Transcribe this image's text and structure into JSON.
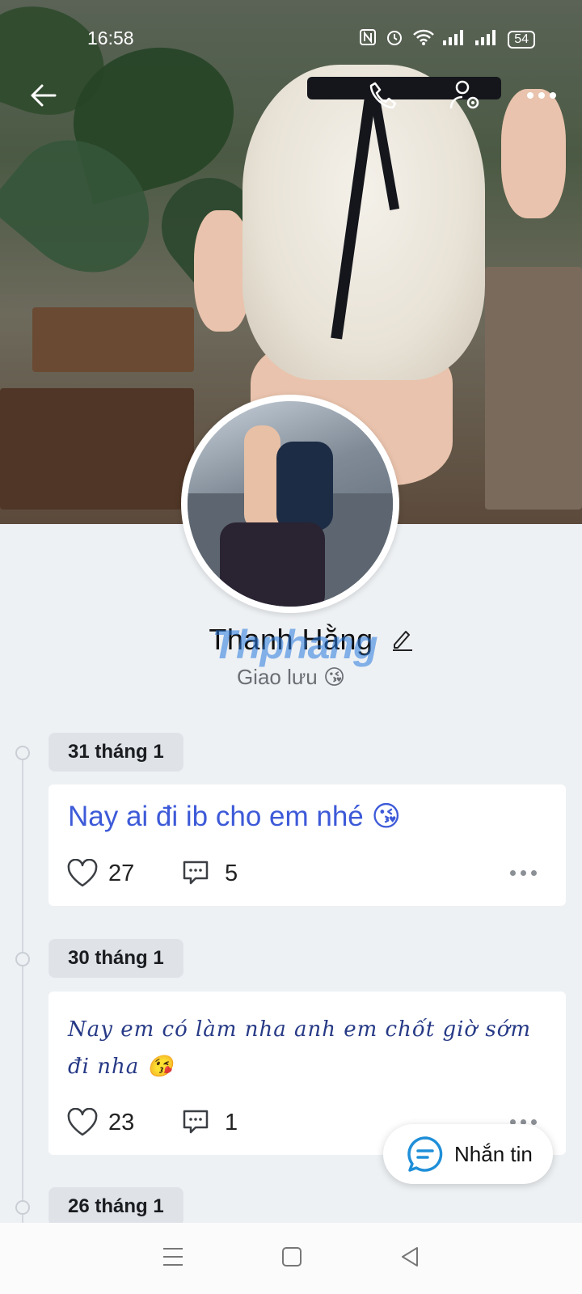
{
  "status_bar": {
    "time": "16:58",
    "battery": "54",
    "icons": [
      "nfc-icon",
      "alarm-icon",
      "wifi-icon",
      "signal-icon",
      "signal-icon",
      "battery-icon"
    ]
  },
  "topbar": {
    "icons": [
      "back-arrow-icon",
      "phone-call-icon",
      "user-settings-icon",
      "more-icon"
    ]
  },
  "profile": {
    "name": "Thanh Hằng",
    "watermark": "Thphang",
    "bio": "Giao lưu 😘"
  },
  "posts": [
    {
      "date": "31 tháng 1",
      "text": "Nay ai đi ib cho em nhé 😘",
      "likes": "27",
      "comments": "5"
    },
    {
      "date": "30 tháng 1",
      "text": "Nay em có làm nha anh em chốt giờ sớm đi nha 😘",
      "likes": "23",
      "comments": "1"
    },
    {
      "date": "26 tháng 1"
    }
  ],
  "fab": {
    "label": "Nhắn tin"
  },
  "nav": {
    "icons": [
      "menu-icon",
      "home-square-icon",
      "back-triangle-icon"
    ]
  },
  "colors": {
    "accent": "#3d5ad8",
    "background": "#eef1f4",
    "chat_blue": "#1f8fd8"
  }
}
